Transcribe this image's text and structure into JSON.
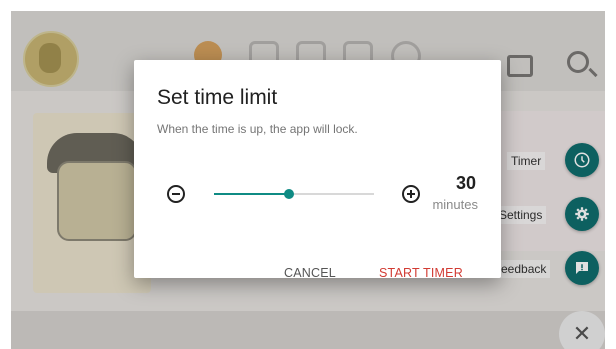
{
  "background": {
    "menu": [
      {
        "label": "Timer",
        "icon": "clock-icon"
      },
      {
        "label": "Settings",
        "icon": "gear-icon"
      },
      {
        "label": "eedback",
        "icon": "feedback-icon"
      }
    ],
    "close_symbol": "✕"
  },
  "dialog": {
    "title": "Set time limit",
    "subtitle": "When the time is up, the app will lock.",
    "minutes_value": "30",
    "minutes_unit": "minutes",
    "slider_fraction": 0.47,
    "cancel_label": "CANCEL",
    "start_label": "START TIMER"
  },
  "colors": {
    "accent": "#0f8b84",
    "fab": "#0f6e6e",
    "start_button": "#d23b33"
  }
}
